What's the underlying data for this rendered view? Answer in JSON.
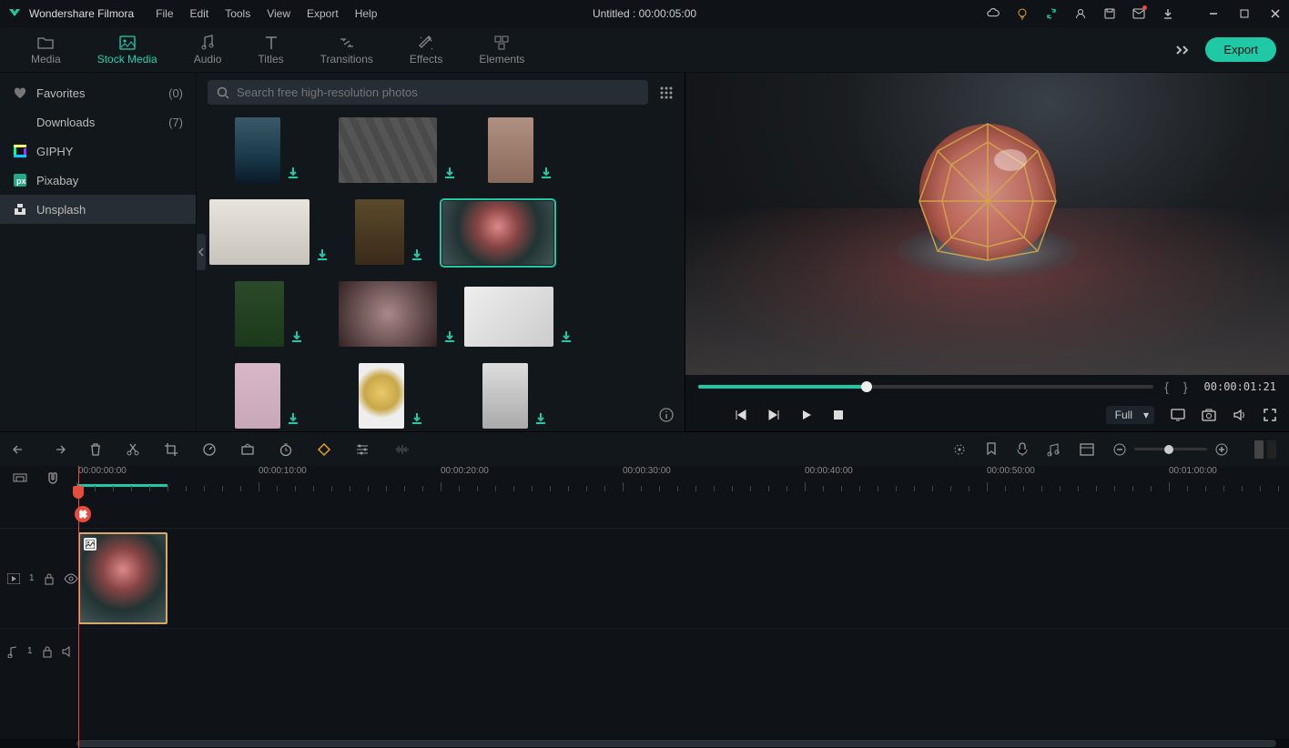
{
  "app_name": "Wondershare Filmora",
  "menus": [
    "File",
    "Edit",
    "Tools",
    "View",
    "Export",
    "Help"
  ],
  "document_title": "Untitled : 00:00:05:00",
  "titlebar_icons": [
    "cloud-icon",
    "lightbulb-icon",
    "sync-icon",
    "user-icon",
    "save-icon",
    "mail-icon",
    "download-icon"
  ],
  "tabs": [
    {
      "label": "Media",
      "icon": "folder-icon"
    },
    {
      "label": "Stock Media",
      "icon": "image-icon",
      "active": true
    },
    {
      "label": "Audio",
      "icon": "music-note-icon"
    },
    {
      "label": "Titles",
      "icon": "text-icon"
    },
    {
      "label": "Transitions",
      "icon": "transitions-icon"
    },
    {
      "label": "Effects",
      "icon": "effects-icon"
    },
    {
      "label": "Elements",
      "icon": "elements-icon"
    }
  ],
  "export_label": "Export",
  "sidebar": [
    {
      "label": "Favorites",
      "count": "(0)",
      "icon": "heart-icon"
    },
    {
      "label": "Downloads",
      "count": "(7)",
      "icon": ""
    },
    {
      "label": "GIPHY",
      "count": "",
      "icon": "giphy-icon"
    },
    {
      "label": "Pixabay",
      "count": "",
      "icon": "pixabay-icon"
    },
    {
      "label": "Unsplash",
      "count": "",
      "icon": "unsplash-icon",
      "active": true
    }
  ],
  "search": {
    "placeholder": "Search free high-resolution photos"
  },
  "preview": {
    "timecode": "00:00:01:21",
    "quality": "Full",
    "brackets": "{   }"
  },
  "timeline": {
    "playhead_time": "00:00:00:00",
    "marks": [
      "00:00:00:00",
      "00:00:10:00",
      "00:00:20:00",
      "00:00:30:00",
      "00:00:40:00",
      "00:00:50:00",
      "00:01:00:00"
    ],
    "video_track_id": "1",
    "audio_track_id": "1"
  }
}
